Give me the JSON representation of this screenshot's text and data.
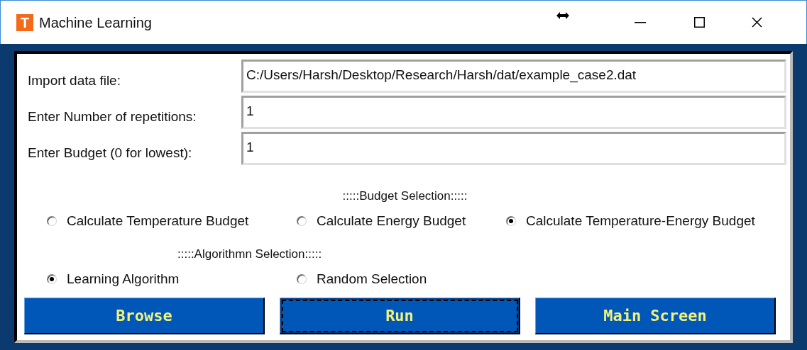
{
  "window": {
    "title": "Machine Learning",
    "icon_letter": "T"
  },
  "fields": [
    {
      "label": "Import data file:",
      "value": "C:/Users/Harsh/Desktop/Research/Harsh/dat/example_case2.dat"
    },
    {
      "label": "Enter Number of repetitions:",
      "value": "1"
    },
    {
      "label": "Enter Budget (0 for lowest):",
      "value": "1"
    }
  ],
  "budget_selection": {
    "heading": ":::::Budget Selection:::::",
    "options": [
      {
        "label": "Calculate Temperature Budget",
        "selected": false
      },
      {
        "label": "Calculate Energy Budget",
        "selected": false
      },
      {
        "label": "Calculate Temperature-Energy Budget",
        "selected": true
      }
    ]
  },
  "algorithm_selection": {
    "heading": ":::::Algorithmn Selection:::::",
    "options": [
      {
        "label": "Learning Algorithm",
        "selected": true
      },
      {
        "label": "Random Selection",
        "selected": false
      }
    ]
  },
  "buttons": [
    {
      "label": "Browse",
      "focused": false
    },
    {
      "label": "Run",
      "focused": true
    },
    {
      "label": "Main Screen",
      "focused": false
    }
  ]
}
